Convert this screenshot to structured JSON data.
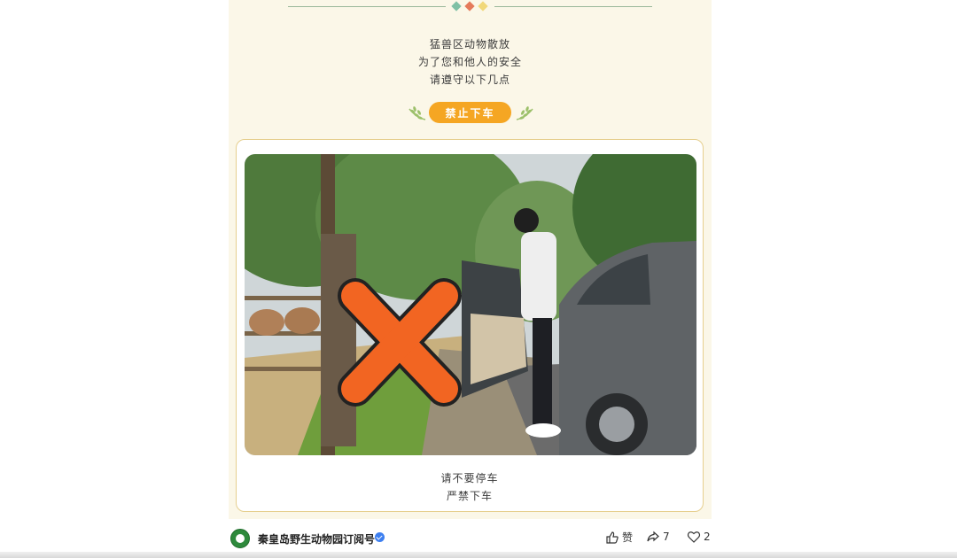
{
  "intro": {
    "line1": "猛兽区动物散放",
    "line2": "为了您和他人的安全",
    "line3": "请遵守以下几点"
  },
  "rule_badge": {
    "label": "禁止下车"
  },
  "photo": {
    "icon": "orange-x-prohibited-icon"
  },
  "caption": {
    "line1": "请不要停车",
    "line2": "严禁下车"
  },
  "footer": {
    "account_name": "秦皇岛野生动物园订阅号",
    "like_label": "赞",
    "share_count": "7",
    "favorite_count": "2"
  },
  "colors": {
    "accent": "#f5a623",
    "background": "#fbf7e8",
    "card_border": "#e6cf8f",
    "x_mark": "#f26522"
  }
}
